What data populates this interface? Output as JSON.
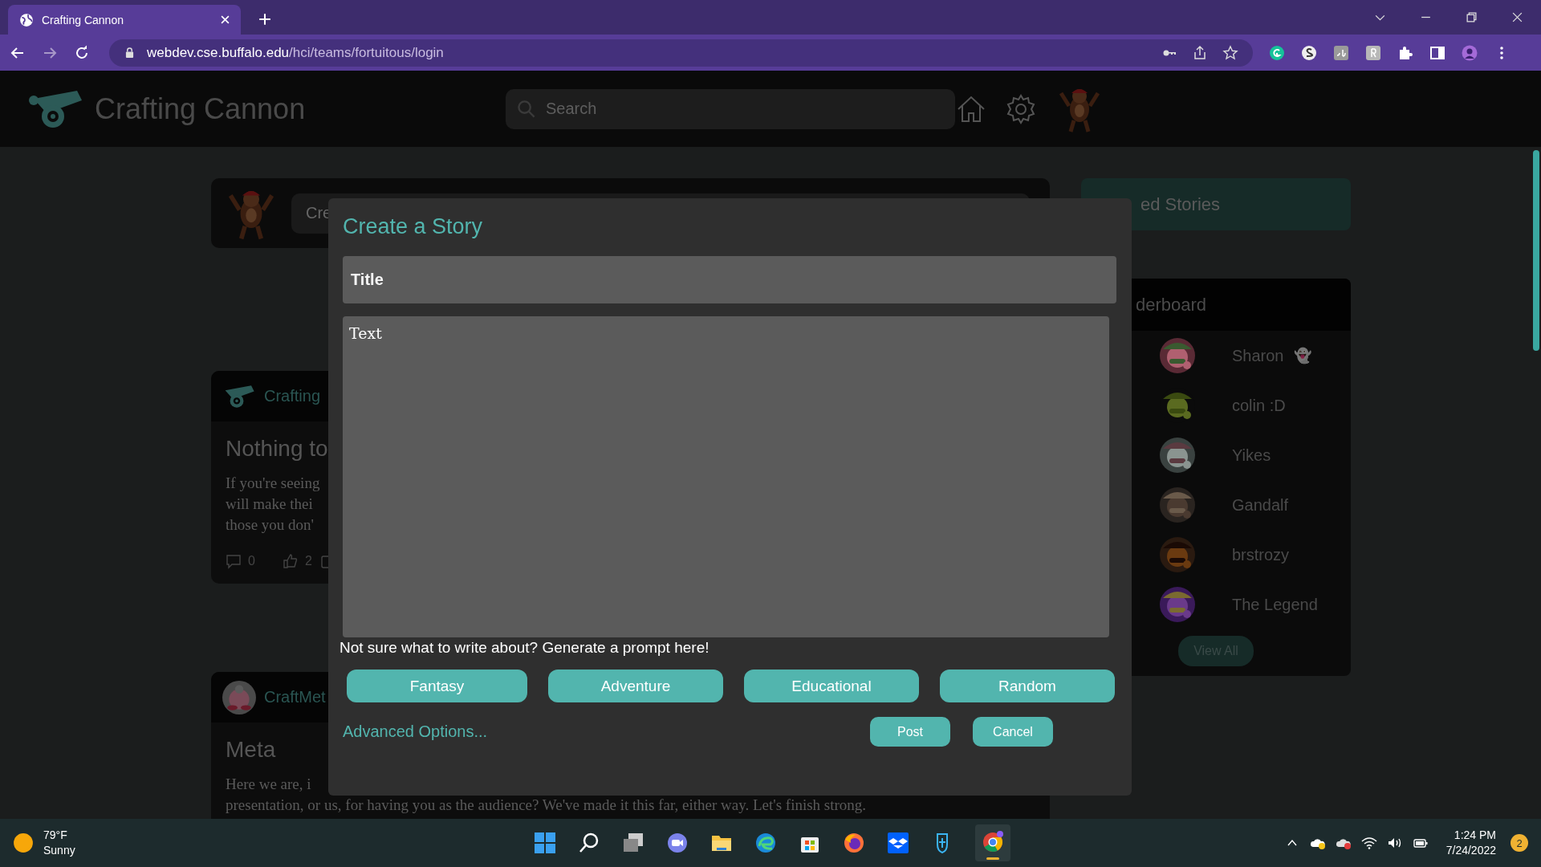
{
  "browser": {
    "tab_title": "Crafting Cannon",
    "url_host": "webdev.cse.buffalo.edu",
    "url_path": "/hci/teams/fortuitous/login"
  },
  "header": {
    "brand": "Crafting Cannon",
    "search_placeholder": "Search"
  },
  "feed": {
    "create_placeholder": "Cre",
    "posts": [
      {
        "author": "Crafting",
        "title": "Nothing to",
        "body": [
          "If you're seeing",
          "will make thei",
          "those you don'"
        ],
        "comments": "0",
        "likes": "2"
      },
      {
        "author": "CraftMet",
        "title": "Meta",
        "body": [
          "Here we are, i",
          "presentation, or us, for having you as the audience? We've made it this far, either way. Let's finish strong."
        ]
      }
    ]
  },
  "sidebar": {
    "archived": "ed Stories",
    "leaderboard_title": "derboard",
    "users": [
      {
        "name": "Sharon",
        "emoji": "👻"
      },
      {
        "name": "colin :D"
      },
      {
        "name": "Yikes"
      },
      {
        "name": "Gandalf"
      },
      {
        "name": "brstrozy"
      },
      {
        "name": "The Legend"
      }
    ],
    "view_all": "View All"
  },
  "modal": {
    "title": "Create a Story",
    "title_placeholder": "Title",
    "text_placeholder": "Text",
    "prompt_hint": "Not sure what to write about? Generate a prompt here!",
    "genres": [
      "Fantasy",
      "Adventure",
      "Educational",
      "Random"
    ],
    "advanced": "Advanced Options...",
    "post": "Post",
    "cancel": "Cancel"
  },
  "taskbar": {
    "temperature": "79°F",
    "weather": "Sunny",
    "time": "1:24 PM",
    "date": "7/24/2022",
    "notifications": "2"
  }
}
